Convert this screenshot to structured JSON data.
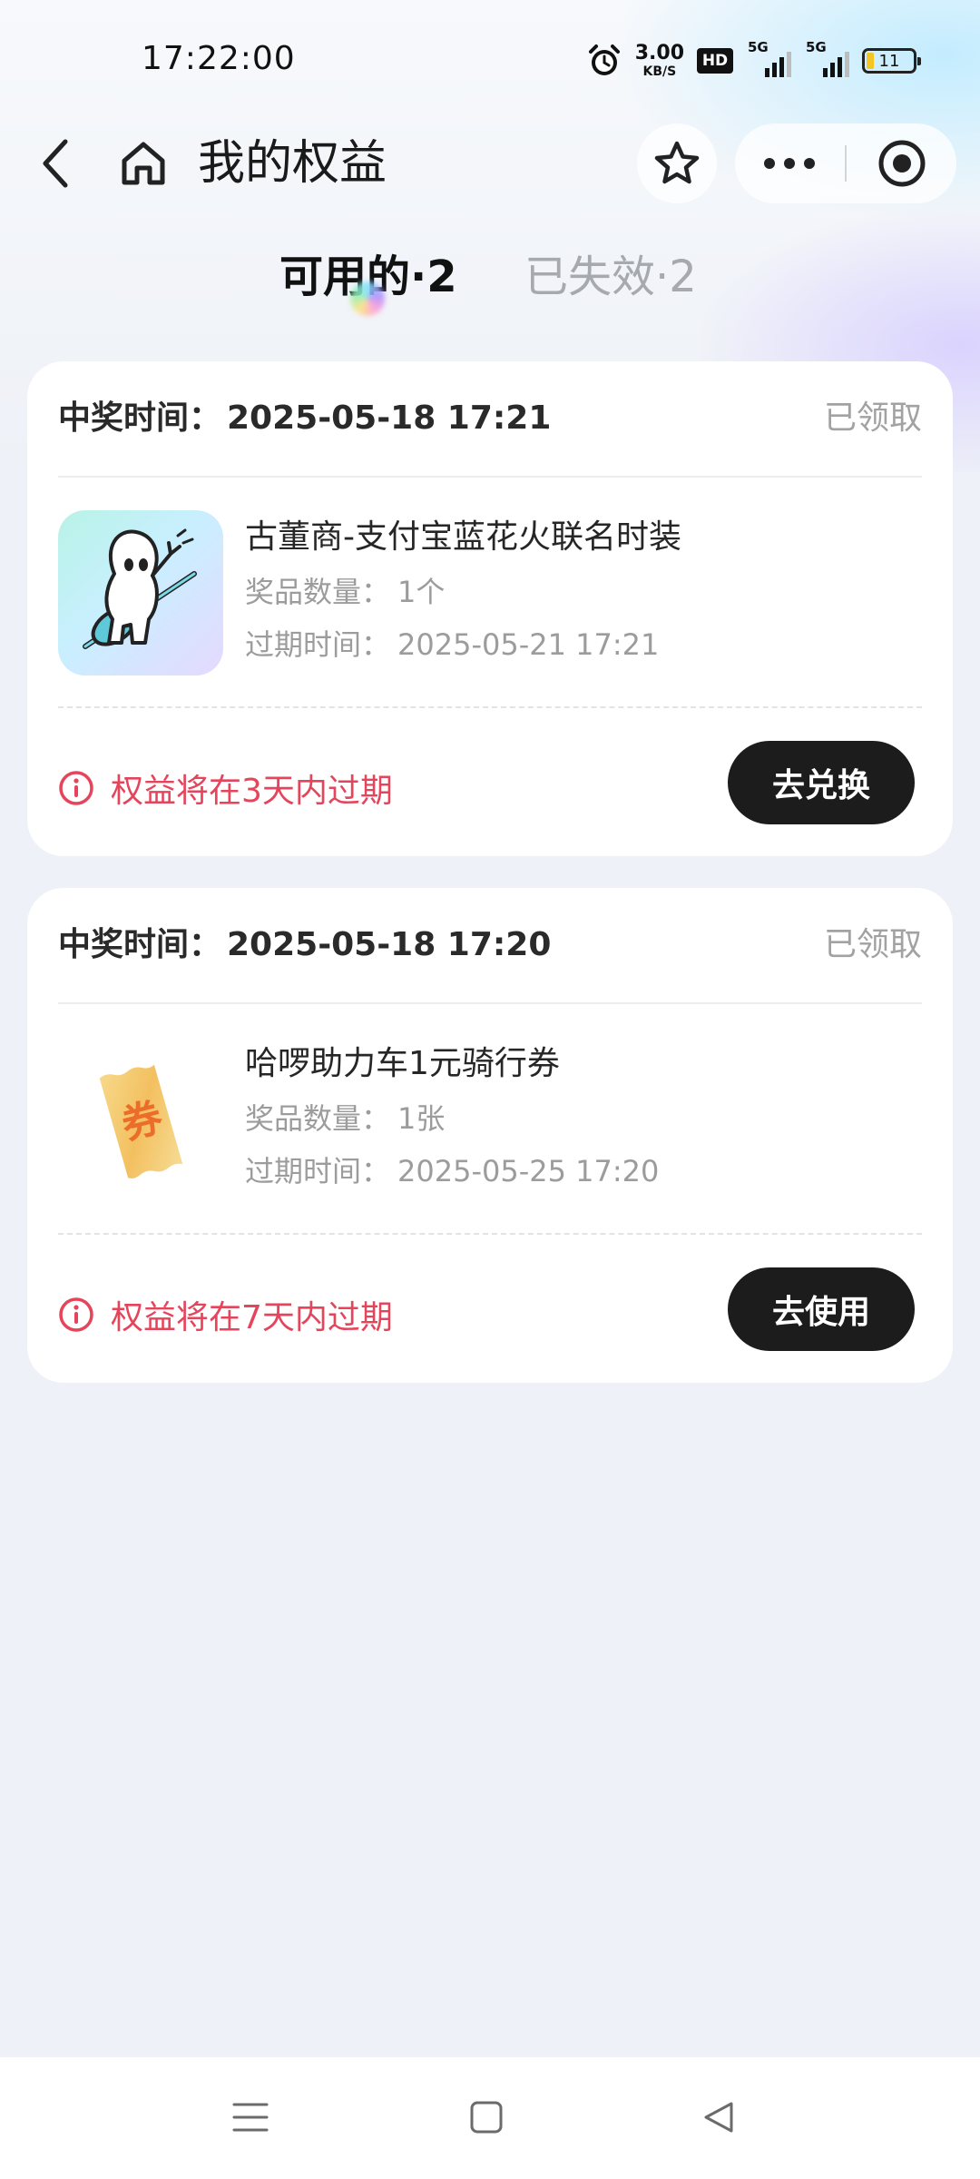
{
  "status_bar": {
    "time": "17:22:00",
    "net_speed_value": "3.00",
    "net_speed_unit": "KB/S",
    "hd_label": "HD",
    "signal_1_label": "5G",
    "signal_2_label": "5G",
    "battery_level": "11",
    "icons": [
      "alarm-icon",
      "hd-icon",
      "signal-icon",
      "signal-icon",
      "battery-icon"
    ]
  },
  "nav": {
    "title": "我的权益",
    "icons": [
      "back-icon",
      "home-icon",
      "star-icon",
      "more-icon",
      "close-mini-program-icon"
    ]
  },
  "tabs": [
    {
      "label": "可用的·2",
      "active": true
    },
    {
      "label": "已失效·2",
      "active": false
    }
  ],
  "labels": {
    "win_time": "中奖时间：",
    "quantity": "奖品数量：",
    "expire": "过期时间："
  },
  "cards": [
    {
      "win_time": "2025-05-18 17:21",
      "status": "已领取",
      "prize_name": "古董商-支付宝蓝花火联名时装",
      "quantity": "1个",
      "expire_time": "2025-05-21 17:21",
      "warning": "权益将在3天内过期",
      "action": "去兑换",
      "image": "mascot-guitar-image"
    },
    {
      "win_time": "2025-05-18 17:20",
      "status": "已领取",
      "prize_name": "哈啰助力车1元骑行券",
      "quantity": "1张",
      "expire_time": "2025-05-25 17:20",
      "warning": "权益将在7天内过期",
      "action": "去使用",
      "image": "coupon-ticket-image",
      "image_text": "券"
    }
  ],
  "colors": {
    "warning": "#e5445b",
    "button_bg": "#1c1c1c",
    "muted": "#9c9c9c"
  }
}
